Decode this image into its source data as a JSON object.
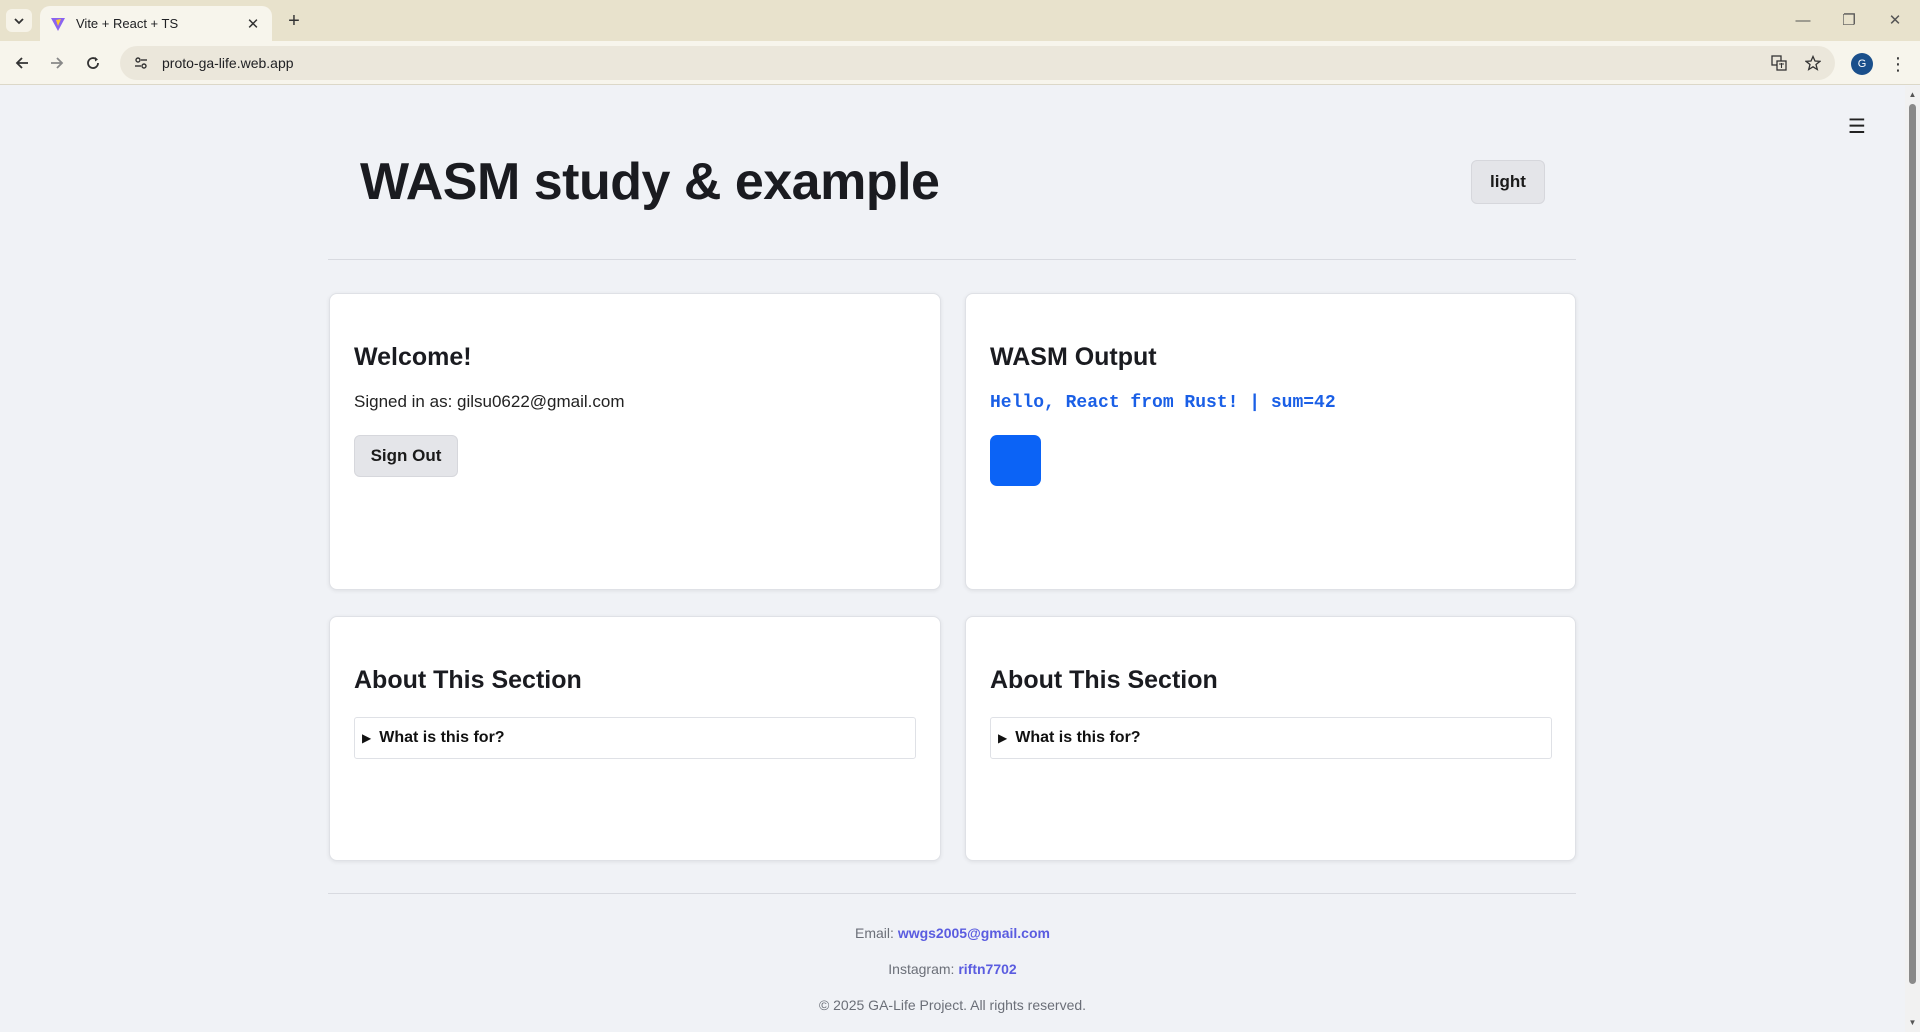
{
  "browser": {
    "tab_title": "Vite + React + TS",
    "url": "proto-ga-life.web.app",
    "profile_initial": "G",
    "icons": [
      "tab-list-icon",
      "vite-favicon",
      "close-icon",
      "plus-icon",
      "minimize-icon",
      "restore-icon",
      "close-window-icon",
      "back-arrow-icon",
      "forward-arrow-icon",
      "reload-icon",
      "site-info-icon",
      "translate-icon",
      "star-icon",
      "more-vert-icon"
    ]
  },
  "header": {
    "title": "WASM study & example",
    "theme_button": "light",
    "menu_icon": "hamburger-icon"
  },
  "welcome_card": {
    "heading": "Welcome!",
    "signed_in_label": "Signed in as: gilsu0622@gmail.com",
    "sign_out_label": "Sign Out"
  },
  "wasm_card": {
    "heading": "WASM Output",
    "output_text": "Hello, React from Rust! | sum=42",
    "box_color": "#0b63f6"
  },
  "about_cards": [
    {
      "heading": "About This Section",
      "summary": "What is this for?"
    },
    {
      "heading": "About This Section",
      "summary": "What is this for?"
    }
  ],
  "footer": {
    "email_label": "Email:",
    "email": "wwgs2005@gmail.com",
    "instagram_label": "Instagram:",
    "instagram": "riftn7702",
    "copyright": "© 2025 GA-Life Project. All rights reserved."
  },
  "colors": {
    "accent_link": "#5a5ce0",
    "wasm_text": "#1a5fe6",
    "page_bg": "#f0f2f6"
  }
}
